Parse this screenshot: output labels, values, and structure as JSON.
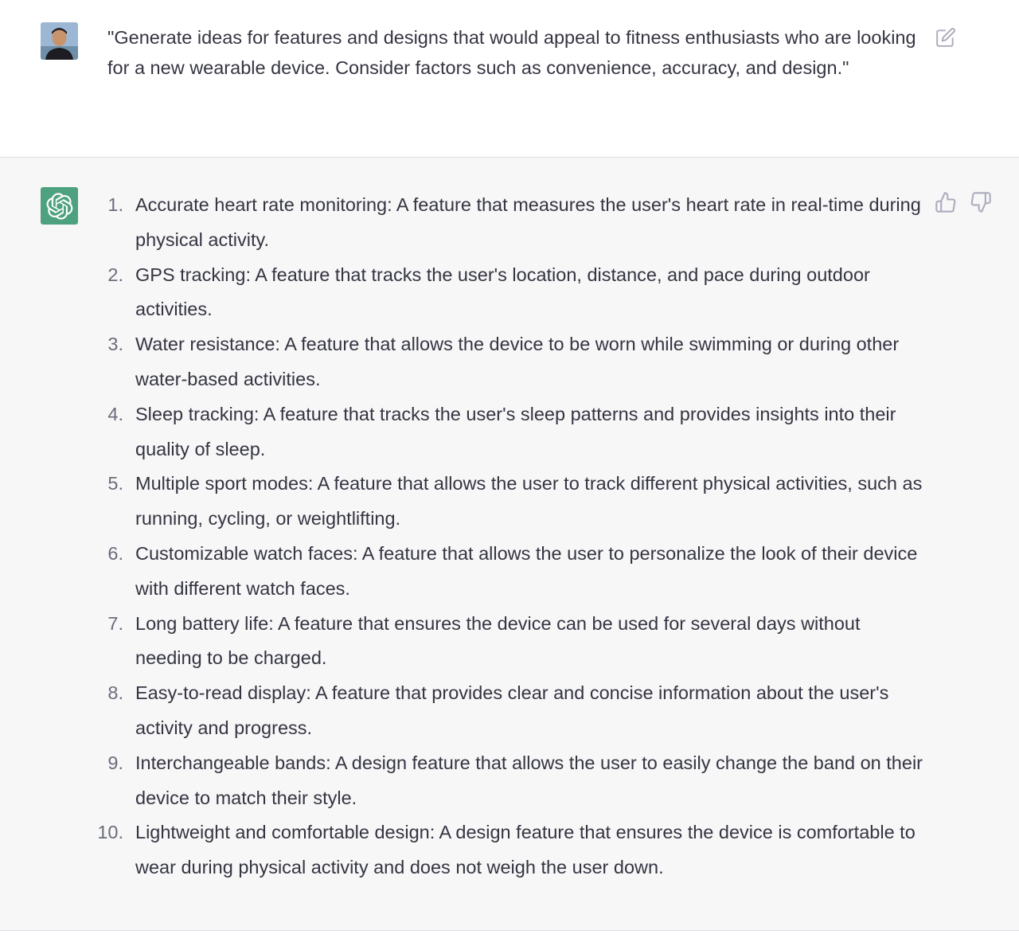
{
  "user_message": {
    "avatar_icon": "user-photo-avatar",
    "text": "\"Generate ideas for features and designs that would appeal to fitness enthusiasts who are looking for a new wearable device. Consider factors such as convenience, accuracy, and design.\"",
    "edit_icon": "edit-icon"
  },
  "assistant_message": {
    "avatar_icon": "openai-logo-icon",
    "avatar_color": "#4ea17f",
    "items": [
      {
        "number": "1.",
        "text": "Accurate heart rate monitoring: A feature that measures the user's heart rate in real-time during physical activity."
      },
      {
        "number": "2.",
        "text": "GPS tracking: A feature that tracks the user's location, distance, and pace during outdoor activities."
      },
      {
        "number": "3.",
        "text": "Water resistance: A feature that allows the device to be worn while swimming or during other water-based activities."
      },
      {
        "number": "4.",
        "text": "Sleep tracking: A feature that tracks the user's sleep patterns and provides insights into their quality of sleep."
      },
      {
        "number": "5.",
        "text": "Multiple sport modes: A feature that allows the user to track different physical activities, such as running, cycling, or weightlifting."
      },
      {
        "number": "6.",
        "text": "Customizable watch faces: A feature that allows the user to personalize the look of their device with different watch faces."
      },
      {
        "number": "7.",
        "text": "Long battery life: A feature that ensures the device can be used for several days without needing to be charged."
      },
      {
        "number": "8.",
        "text": "Easy-to-read display: A feature that provides clear and concise information about the user's activity and progress."
      },
      {
        "number": "9.",
        "text": "Interchangeable bands: A design feature that allows the user to easily change the band on their device to match their style."
      },
      {
        "number": "10.",
        "text": "Lightweight and comfortable design: A design feature that ensures the device is comfortable to wear during physical activity and does not weigh the user down."
      }
    ],
    "thumb_up_icon": "thumbs-up-icon",
    "thumb_down_icon": "thumbs-down-icon"
  },
  "colors": {
    "user_bg": "#ffffff",
    "assistant_bg": "#f7f7f8",
    "text": "#343541",
    "icon": "#acacbe"
  }
}
